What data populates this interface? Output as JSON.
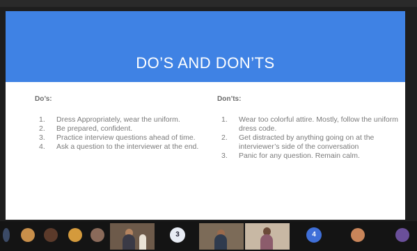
{
  "slide": {
    "title": "DO’S AND DON’TS",
    "dos": {
      "heading": "Do’s:",
      "items": [
        {
          "num": "1.",
          "text": "Dress Appropriately, wear the uniform."
        },
        {
          "num": "2.",
          "text": "Be prepared, confident."
        },
        {
          "num": "3.",
          "text": "Practice interview questions ahead of time."
        },
        {
          "num": "4.",
          "text": "Ask a question to the interviewer at the end."
        }
      ]
    },
    "donts": {
      "heading": "Don’ts:",
      "items": [
        {
          "num": "1.",
          "text": "Wear too colorful attire. Mostly, follow the uniform dress code."
        },
        {
          "num": "2.",
          "text": "Get distracted by anything going on at the interviewer’s side of the conversation"
        },
        {
          "num": "3.",
          "text": "Panic for any question. Remain calm."
        }
      ]
    }
  },
  "participants": {
    "badge_a": "3",
    "badge_b": "4"
  },
  "colors": {
    "header": "#3f82e4",
    "strip": "#141414"
  }
}
